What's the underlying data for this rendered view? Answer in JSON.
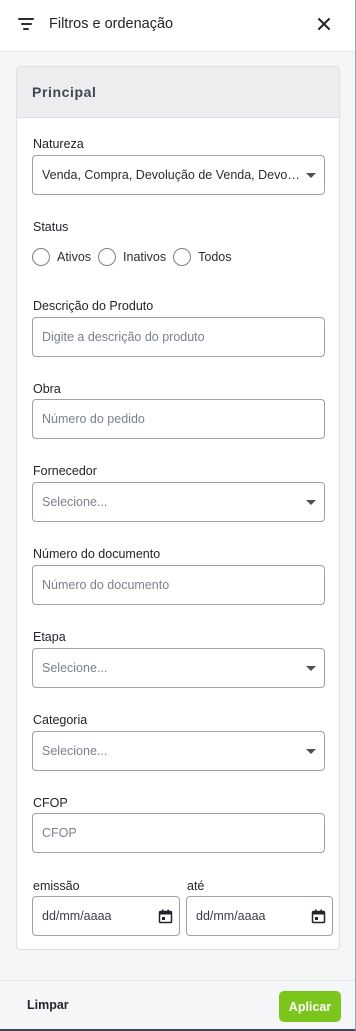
{
  "header": {
    "title": "Filtros e ordenação",
    "filter_icon": "filter-icon",
    "close_icon": "close-icon"
  },
  "section": {
    "title": "Principal"
  },
  "fields": {
    "natureza": {
      "label": "Natureza",
      "value": "Venda, Compra, Devolução de Venda, Devolução de Compra"
    },
    "status": {
      "label": "Status",
      "options": [
        "Ativos",
        "Inativos",
        "Todos"
      ]
    },
    "descricao": {
      "label": "Descrição do Produto",
      "placeholder": "Digite a descrição do produto"
    },
    "obra": {
      "label": "Obra",
      "placeholder": "Número do pedido"
    },
    "fornecedor": {
      "label": "Fornecedor",
      "placeholder": "Selecione..."
    },
    "numero_documento": {
      "label": "Número do documento",
      "placeholder": "Número do documento"
    },
    "etapa": {
      "label": "Etapa",
      "placeholder": "Selecione..."
    },
    "categoria": {
      "label": "Categoria",
      "placeholder": "Selecione..."
    },
    "cfop": {
      "label": "CFOP",
      "placeholder": "CFOP"
    },
    "emissao": {
      "label": "emissão",
      "placeholder": "dd/mm/aaaa"
    },
    "ate": {
      "label": "até",
      "placeholder": "dd/mm/aaaa"
    }
  },
  "footer": {
    "clear_label": "Limpar",
    "apply_label": "Aplicar"
  },
  "colors": {
    "accent": "#7bc51d",
    "border": "#9ba2ab",
    "section_header_bg": "#ebedef"
  }
}
